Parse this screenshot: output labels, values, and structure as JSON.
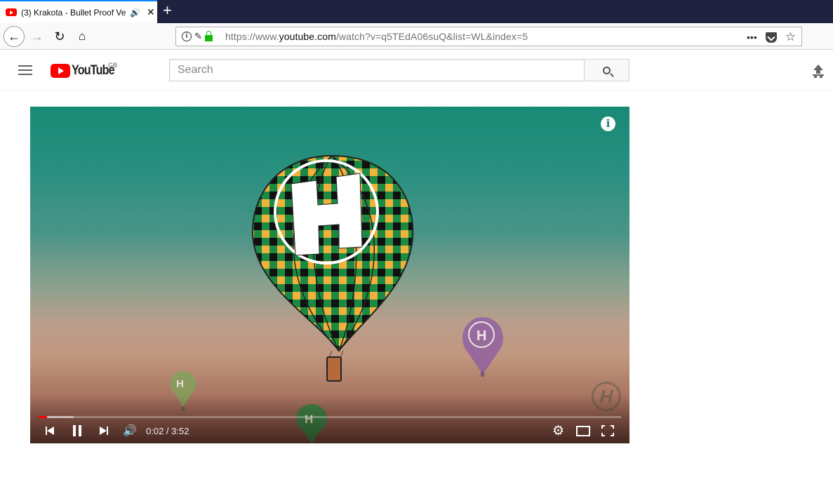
{
  "browser": {
    "tab": {
      "title": "(3) Krakota - Bullet Proof Ve",
      "audio_icon": "speaker-icon",
      "close_label": "✕"
    },
    "new_tab_label": "+",
    "nav": {
      "back": "←",
      "forward": "→",
      "reload": "↻",
      "home": "⌂"
    },
    "url": {
      "prefix": "https://www.",
      "domain": "youtube.com",
      "path": "/watch?v=q5TEdA06suQ&list=WL&index=5"
    },
    "page_actions": "•••"
  },
  "youtube": {
    "logo_text": "YouTube",
    "region": "GB",
    "search_placeholder": "Search"
  },
  "player": {
    "info_label": "i",
    "watermark": "H",
    "time": "0:02 / 3:52",
    "progress_played": 0.002,
    "progress_loaded": 0.06,
    "volume_glyph": "🔊",
    "settings_glyph": "⚙"
  },
  "colors": {
    "accent_tab": "#0a84ff",
    "yt_red": "#ff0000",
    "tabstrip": "#202340"
  }
}
